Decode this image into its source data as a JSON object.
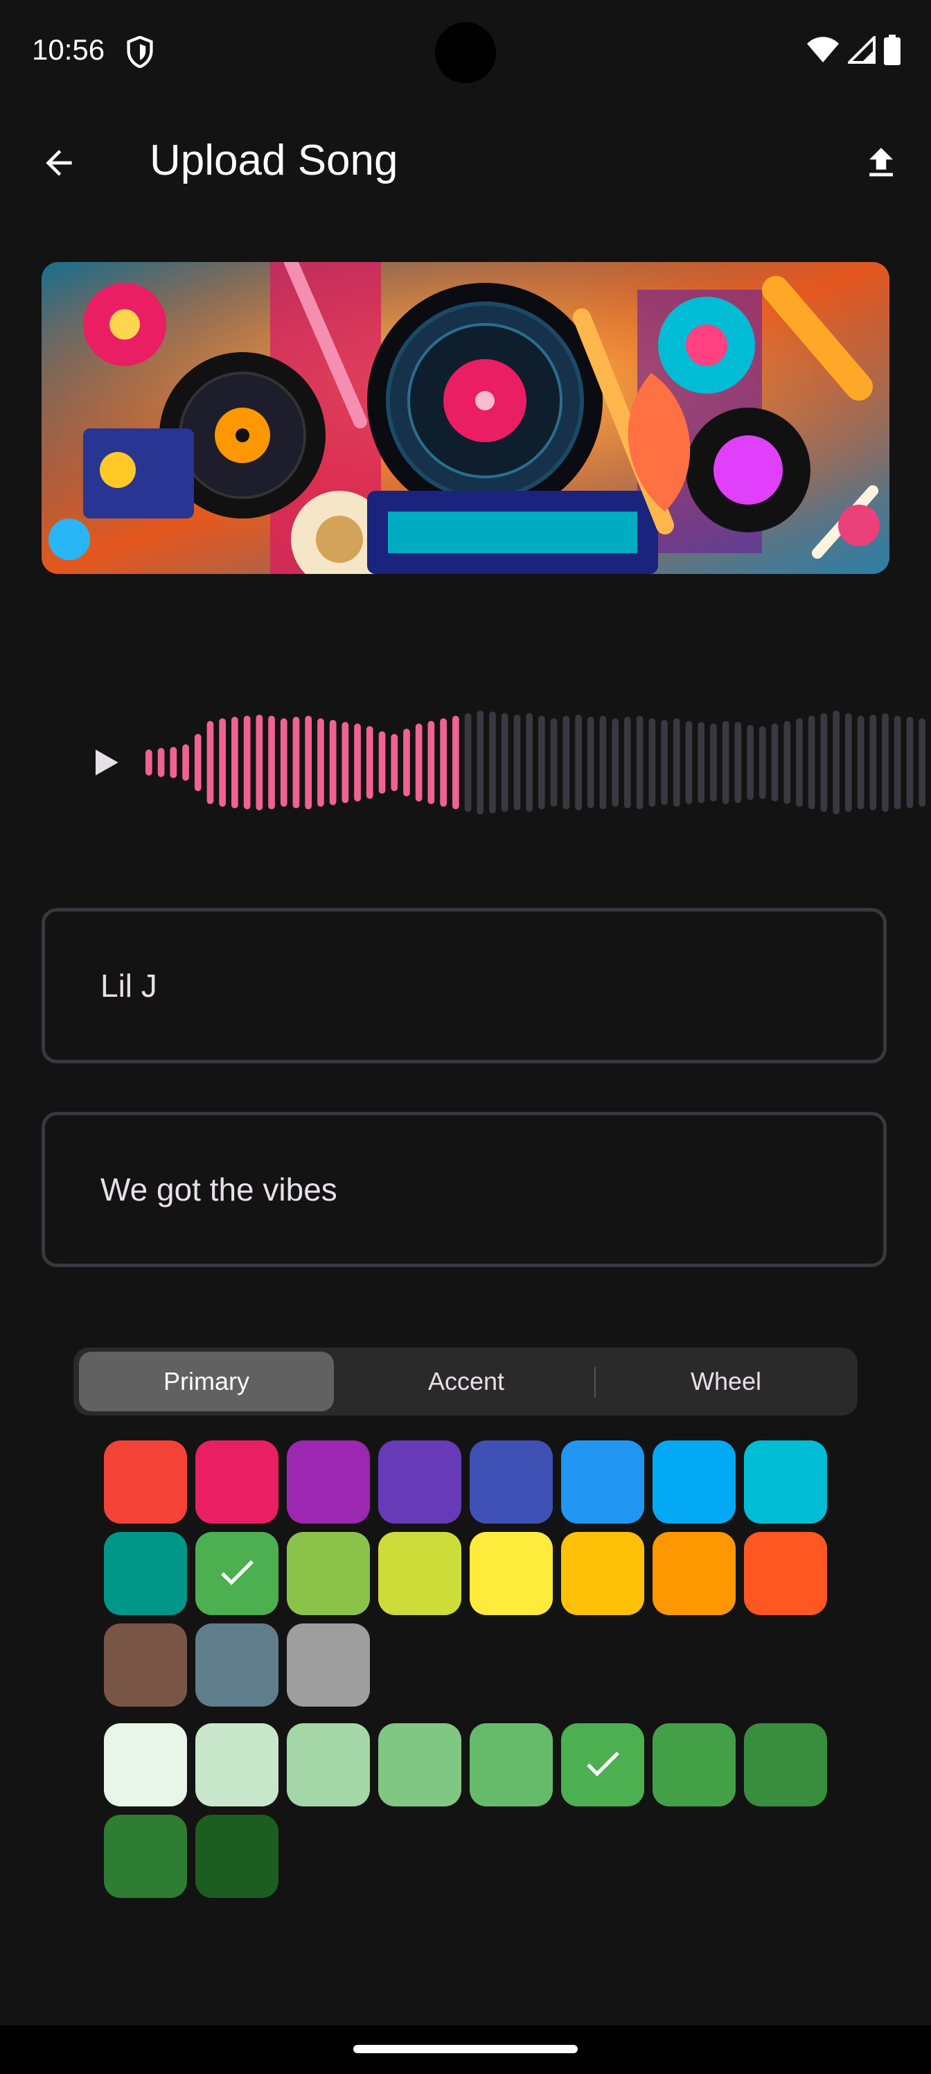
{
  "status": {
    "time": "10:56",
    "icons": [
      "shield-icon",
      "wifi-icon",
      "signal-icon",
      "battery-icon"
    ]
  },
  "appbar": {
    "title": "Upload Song",
    "back_icon": "arrow-back-icon",
    "upload_icon": "upload-icon"
  },
  "player": {
    "play_icon": "play-icon",
    "progress": 0.41,
    "played_color": "#f06292",
    "unplayed_color": "#3a3840"
  },
  "form": {
    "artist_value": "Lil J",
    "title_value": "We got the vibes"
  },
  "color_picker": {
    "tabs": [
      "Primary",
      "Accent",
      "Wheel"
    ],
    "selected_tab": "Primary",
    "primary_swatches": [
      "#f44336",
      "#e91e63",
      "#9c27b0",
      "#673ab7",
      "#3f51b5",
      "#2196f3",
      "#03a9f4",
      "#00bcd4",
      "#009688",
      "#4caf50",
      "#8bc34a",
      "#cddc39",
      "#ffeb3b",
      "#ffc107",
      "#ff9800",
      "#ff5722",
      "#795548",
      "#607d8b",
      "#9e9e9e"
    ],
    "selected_primary": "#4caf50",
    "shade_swatches": [
      "#e8f5e9",
      "#c8e6c9",
      "#a5d6a7",
      "#81c784",
      "#66bb6a",
      "#4caf50",
      "#43a047",
      "#388e3c",
      "#2e7d32",
      "#1b5e20"
    ],
    "selected_shade": "#4caf50"
  }
}
